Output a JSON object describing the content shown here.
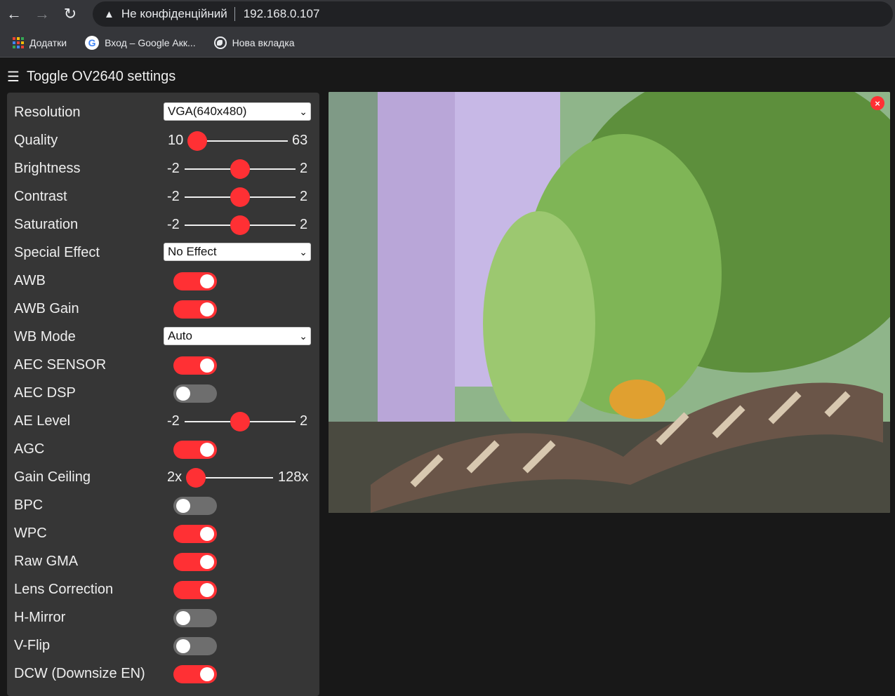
{
  "browser": {
    "insecure_label": "Не конфіденційний",
    "url": "192.168.0.107",
    "bookmarks": [
      {
        "label": "Додатки",
        "icon": "apps-grid-icon"
      },
      {
        "label": "Вход – Google Акк...",
        "icon": "google-icon"
      },
      {
        "label": "Нова вкладка",
        "icon": "globe-icon"
      }
    ]
  },
  "page": {
    "menu_icon": "☰",
    "title": "Toggle OV2640 settings"
  },
  "settings": {
    "resolution": {
      "label": "Resolution",
      "value": "VGA(640x480)"
    },
    "quality": {
      "label": "Quality",
      "min": "10",
      "max": "63",
      "value": 10
    },
    "brightness": {
      "label": "Brightness",
      "min": "-2",
      "max": "2",
      "value": 0
    },
    "contrast": {
      "label": "Contrast",
      "min": "-2",
      "max": "2",
      "value": 0
    },
    "saturation": {
      "label": "Saturation",
      "min": "-2",
      "max": "2",
      "value": 0
    },
    "special_effect": {
      "label": "Special Effect",
      "value": "No Effect"
    },
    "awb": {
      "label": "AWB",
      "on": true
    },
    "awb_gain": {
      "label": "AWB Gain",
      "on": true
    },
    "wb_mode": {
      "label": "WB Mode",
      "value": "Auto"
    },
    "aec_sensor": {
      "label": "AEC SENSOR",
      "on": true
    },
    "aec_dsp": {
      "label": "AEC DSP",
      "on": false
    },
    "ae_level": {
      "label": "AE Level",
      "min": "-2",
      "max": "2",
      "value": 0
    },
    "agc": {
      "label": "AGC",
      "on": true
    },
    "gain_ceiling": {
      "label": "Gain Ceiling",
      "min": "2x",
      "max": "128x",
      "value": 0
    },
    "bpc": {
      "label": "BPC",
      "on": false
    },
    "wpc": {
      "label": "WPC",
      "on": true
    },
    "raw_gma": {
      "label": "Raw GMA",
      "on": true
    },
    "lens_correction": {
      "label": "Lens Correction",
      "on": true
    },
    "hmirror": {
      "label": "H-Mirror",
      "on": false
    },
    "vflip": {
      "label": "V-Flip",
      "on": false
    },
    "dcw": {
      "label": "DCW (Downsize EN)",
      "on": true
    }
  },
  "stream": {
    "close_icon": "×"
  },
  "colors": {
    "accent": "#ff3034",
    "panel": "#363636",
    "background": "#181818"
  }
}
